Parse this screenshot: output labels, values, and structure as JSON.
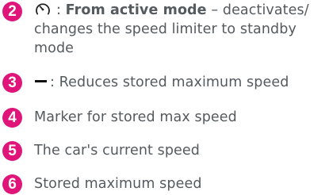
{
  "items": [
    {
      "number": "2",
      "icon": "gauge-icon",
      "colon": ":",
      "bold": "From active mode",
      "dash": "–",
      "text": "deactivates/ changes the speed limiter to standby mode"
    },
    {
      "number": "3",
      "icon": "minus-icon",
      "colon": ":",
      "text": "Reduces stored maximum speed"
    },
    {
      "number": "4",
      "text": "Marker for stored max speed"
    },
    {
      "number": "5",
      "text": "The car's current speed"
    },
    {
      "number": "6",
      "text": "Stored maximum speed"
    }
  ],
  "colors": {
    "badge": "#e0157a",
    "text": "#555a5e"
  }
}
